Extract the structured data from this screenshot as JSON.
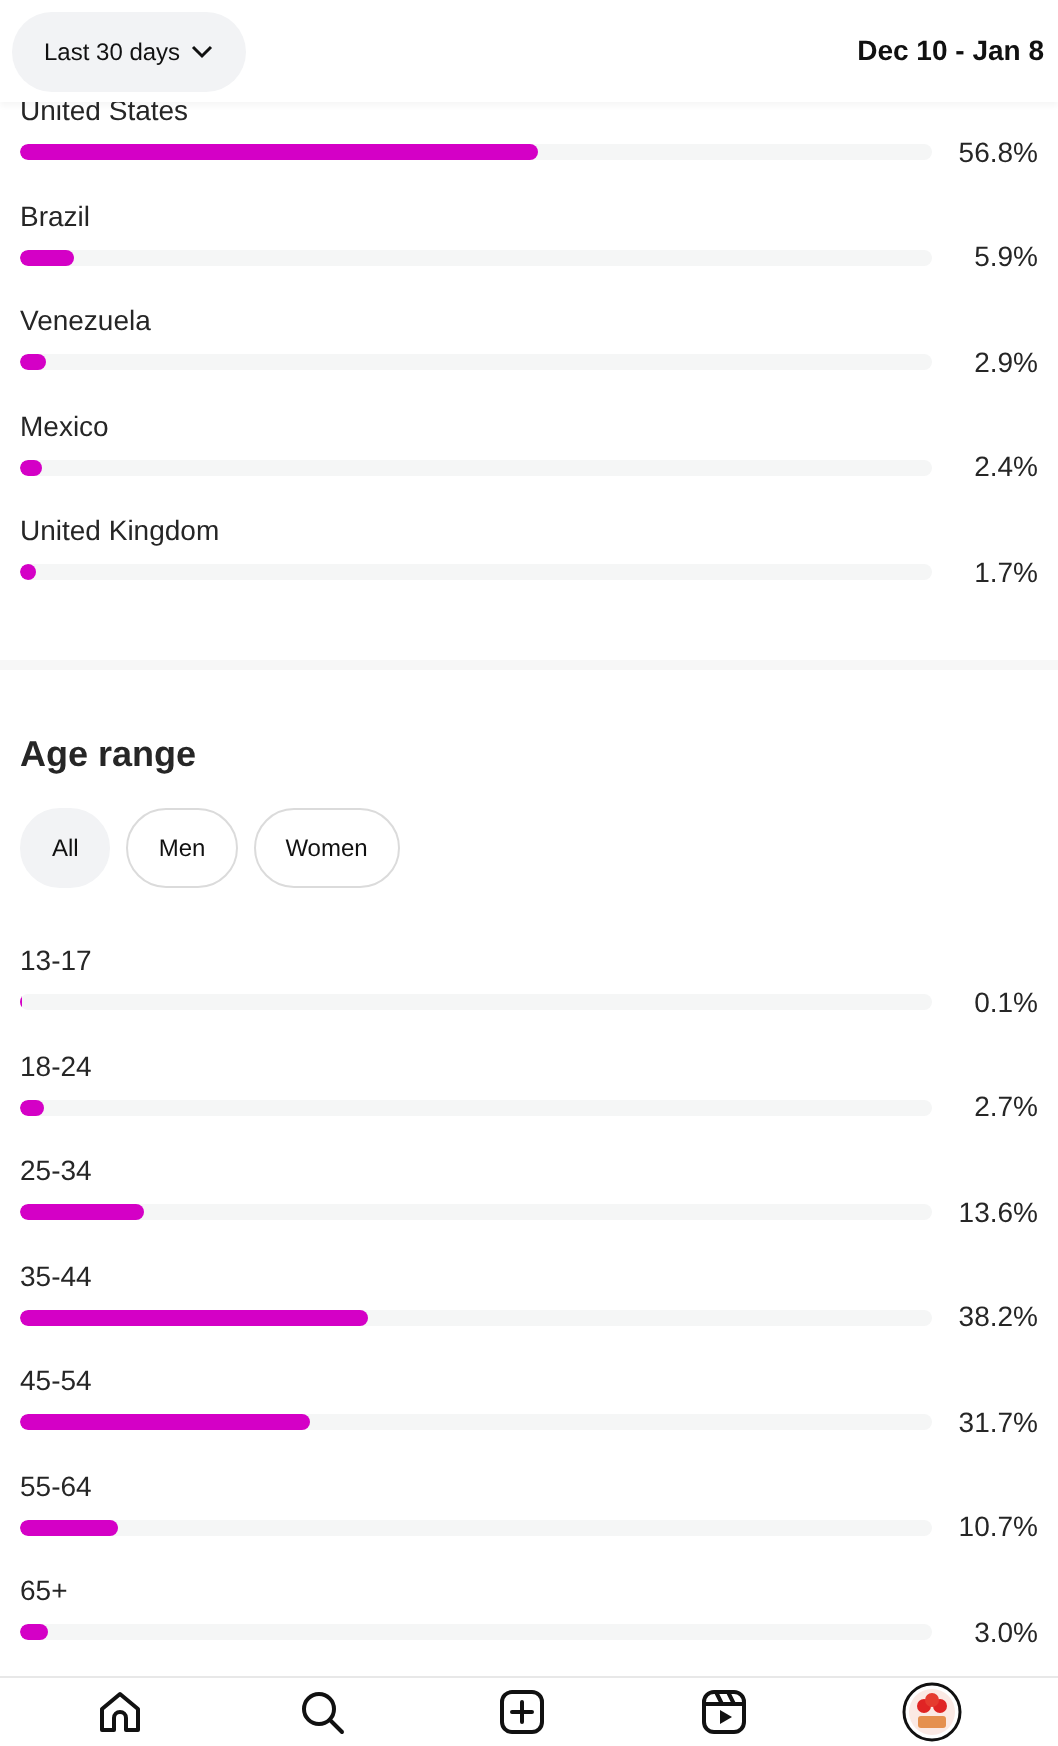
{
  "header": {
    "period_button": "Last 30 days",
    "date_range": "Dec 10 - Jan 8"
  },
  "countries": [
    {
      "name": "United States",
      "level": 0.568,
      "percent": "56.8%"
    },
    {
      "name": "Brazil",
      "level": 0.059,
      "percent": "5.9%"
    },
    {
      "name": "Venezuela",
      "level": 0.029,
      "percent": "2.9%"
    },
    {
      "name": "Mexico",
      "level": 0.024,
      "percent": "2.4%"
    },
    {
      "name": "United Kingdom",
      "level": 0.017,
      "percent": "1.7%"
    }
  ],
  "age_range": {
    "title": "Age range",
    "filters": [
      {
        "label": "All",
        "selected": true
      },
      {
        "label": "Men",
        "selected": false
      },
      {
        "label": "Women",
        "selected": false
      }
    ],
    "rows": [
      {
        "name": "13-17",
        "level": 0.001,
        "percent": "0.1%"
      },
      {
        "name": "18-24",
        "level": 0.027,
        "percent": "2.7%"
      },
      {
        "name": "25-34",
        "level": 0.136,
        "percent": "13.6%"
      },
      {
        "name": "35-44",
        "level": 0.382,
        "percent": "38.2%"
      },
      {
        "name": "45-54",
        "level": 0.317,
        "percent": "31.7%"
      },
      {
        "name": "55-64",
        "level": 0.107,
        "percent": "10.7%"
      },
      {
        "name": "65+",
        "level": 0.03,
        "percent": "3.0%"
      }
    ]
  }
}
